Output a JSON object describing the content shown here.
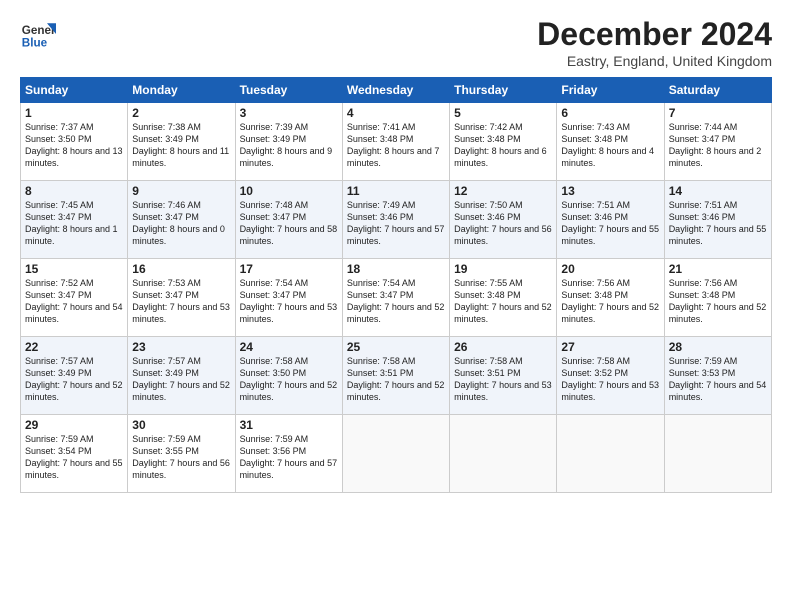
{
  "logo": {
    "text_general": "General",
    "text_blue": "Blue"
  },
  "header": {
    "month": "December 2024",
    "location": "Eastry, England, United Kingdom"
  },
  "weekdays": [
    "Sunday",
    "Monday",
    "Tuesday",
    "Wednesday",
    "Thursday",
    "Friday",
    "Saturday"
  ],
  "weeks": [
    [
      {
        "day": "1",
        "sunrise": "7:37 AM",
        "sunset": "3:50 PM",
        "daylight": "8 hours and 13 minutes."
      },
      {
        "day": "2",
        "sunrise": "7:38 AM",
        "sunset": "3:49 PM",
        "daylight": "8 hours and 11 minutes."
      },
      {
        "day": "3",
        "sunrise": "7:39 AM",
        "sunset": "3:49 PM",
        "daylight": "8 hours and 9 minutes."
      },
      {
        "day": "4",
        "sunrise": "7:41 AM",
        "sunset": "3:48 PM",
        "daylight": "8 hours and 7 minutes."
      },
      {
        "day": "5",
        "sunrise": "7:42 AM",
        "sunset": "3:48 PM",
        "daylight": "8 hours and 6 minutes."
      },
      {
        "day": "6",
        "sunrise": "7:43 AM",
        "sunset": "3:48 PM",
        "daylight": "8 hours and 4 minutes."
      },
      {
        "day": "7",
        "sunrise": "7:44 AM",
        "sunset": "3:47 PM",
        "daylight": "8 hours and 2 minutes."
      }
    ],
    [
      {
        "day": "8",
        "sunrise": "7:45 AM",
        "sunset": "3:47 PM",
        "daylight": "8 hours and 1 minute."
      },
      {
        "day": "9",
        "sunrise": "7:46 AM",
        "sunset": "3:47 PM",
        "daylight": "8 hours and 0 minutes."
      },
      {
        "day": "10",
        "sunrise": "7:48 AM",
        "sunset": "3:47 PM",
        "daylight": "7 hours and 58 minutes."
      },
      {
        "day": "11",
        "sunrise": "7:49 AM",
        "sunset": "3:46 PM",
        "daylight": "7 hours and 57 minutes."
      },
      {
        "day": "12",
        "sunrise": "7:50 AM",
        "sunset": "3:46 PM",
        "daylight": "7 hours and 56 minutes."
      },
      {
        "day": "13",
        "sunrise": "7:51 AM",
        "sunset": "3:46 PM",
        "daylight": "7 hours and 55 minutes."
      },
      {
        "day": "14",
        "sunrise": "7:51 AM",
        "sunset": "3:46 PM",
        "daylight": "7 hours and 55 minutes."
      }
    ],
    [
      {
        "day": "15",
        "sunrise": "7:52 AM",
        "sunset": "3:47 PM",
        "daylight": "7 hours and 54 minutes."
      },
      {
        "day": "16",
        "sunrise": "7:53 AM",
        "sunset": "3:47 PM",
        "daylight": "7 hours and 53 minutes."
      },
      {
        "day": "17",
        "sunrise": "7:54 AM",
        "sunset": "3:47 PM",
        "daylight": "7 hours and 53 minutes."
      },
      {
        "day": "18",
        "sunrise": "7:54 AM",
        "sunset": "3:47 PM",
        "daylight": "7 hours and 52 minutes."
      },
      {
        "day": "19",
        "sunrise": "7:55 AM",
        "sunset": "3:48 PM",
        "daylight": "7 hours and 52 minutes."
      },
      {
        "day": "20",
        "sunrise": "7:56 AM",
        "sunset": "3:48 PM",
        "daylight": "7 hours and 52 minutes."
      },
      {
        "day": "21",
        "sunrise": "7:56 AM",
        "sunset": "3:48 PM",
        "daylight": "7 hours and 52 minutes."
      }
    ],
    [
      {
        "day": "22",
        "sunrise": "7:57 AM",
        "sunset": "3:49 PM",
        "daylight": "7 hours and 52 minutes."
      },
      {
        "day": "23",
        "sunrise": "7:57 AM",
        "sunset": "3:49 PM",
        "daylight": "7 hours and 52 minutes."
      },
      {
        "day": "24",
        "sunrise": "7:58 AM",
        "sunset": "3:50 PM",
        "daylight": "7 hours and 52 minutes."
      },
      {
        "day": "25",
        "sunrise": "7:58 AM",
        "sunset": "3:51 PM",
        "daylight": "7 hours and 52 minutes."
      },
      {
        "day": "26",
        "sunrise": "7:58 AM",
        "sunset": "3:51 PM",
        "daylight": "7 hours and 53 minutes."
      },
      {
        "day": "27",
        "sunrise": "7:58 AM",
        "sunset": "3:52 PM",
        "daylight": "7 hours and 53 minutes."
      },
      {
        "day": "28",
        "sunrise": "7:59 AM",
        "sunset": "3:53 PM",
        "daylight": "7 hours and 54 minutes."
      }
    ],
    [
      {
        "day": "29",
        "sunrise": "7:59 AM",
        "sunset": "3:54 PM",
        "daylight": "7 hours and 55 minutes."
      },
      {
        "day": "30",
        "sunrise": "7:59 AM",
        "sunset": "3:55 PM",
        "daylight": "7 hours and 56 minutes."
      },
      {
        "day": "31",
        "sunrise": "7:59 AM",
        "sunset": "3:56 PM",
        "daylight": "7 hours and 57 minutes."
      },
      null,
      null,
      null,
      null
    ]
  ]
}
